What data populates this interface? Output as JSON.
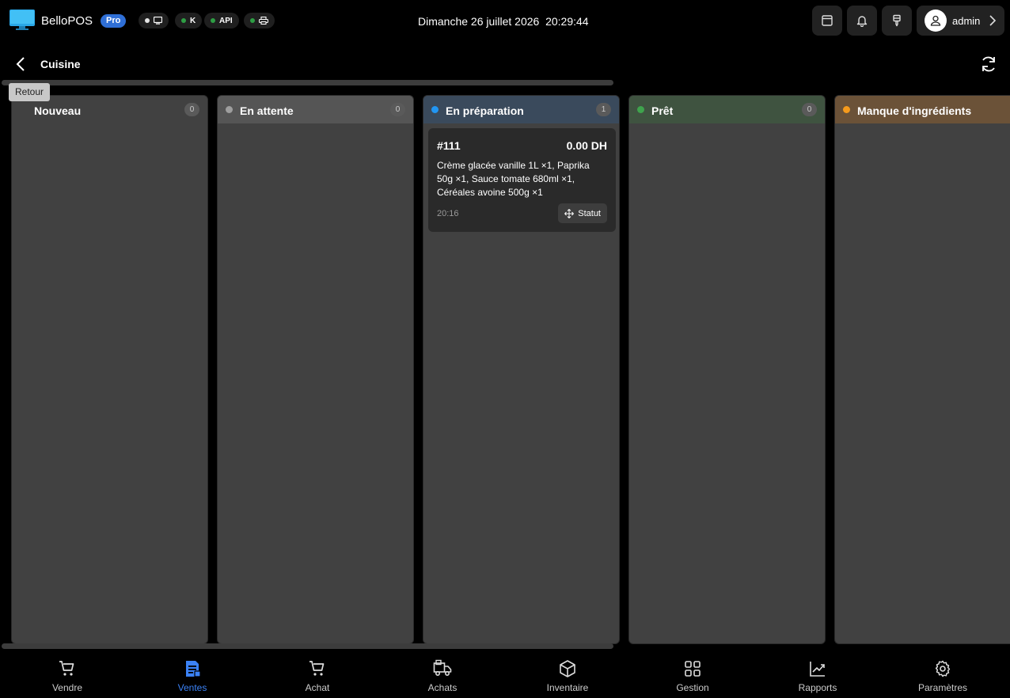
{
  "header": {
    "app_name": "BelloPOS",
    "badge": "Pro",
    "status_pills": [
      {
        "icon": "monitor-icon",
        "label": "",
        "dot_color": "#e5e5e5"
      },
      {
        "icon": "",
        "label": "K",
        "dot_color": "#2e9e44"
      },
      {
        "icon": "",
        "label": "API",
        "dot_color": "#2e9e44"
      },
      {
        "icon": "printer-icon",
        "label": "",
        "dot_color": "#2e9e44"
      }
    ],
    "datetime": "Dimanche 26 juillet 2026  20:29:44",
    "user": "admin"
  },
  "subheader": {
    "title": "Cuisine",
    "back_tooltip": "Retour"
  },
  "columns": [
    {
      "title": "Nouveau",
      "count": "0",
      "dot_color": "",
      "header_color": "#414141"
    },
    {
      "title": "En attente",
      "count": "0",
      "dot_color": "#9e9e9e",
      "header_color": "#555555"
    },
    {
      "title": "En préparation",
      "count": "1",
      "dot_color": "#2196f3",
      "header_color": "#3a4a5c"
    },
    {
      "title": "Prêt",
      "count": "0",
      "dot_color": "#3fa34d",
      "header_color": "#3f5340"
    },
    {
      "title": "Manque d'ingrédients",
      "count": "",
      "dot_color": "#f59a1c",
      "header_color": "#6b5238"
    }
  ],
  "order": {
    "number": "#111",
    "total": "0.00 DH",
    "items": "Crème glacée vanille 1L ×1, Paprika 50g ×1, Sauce tomate 680ml ×1, Céréales avoine 500g ×1",
    "time": "20:16",
    "status_label": "Statut"
  },
  "nav": [
    {
      "label": "Vendre",
      "icon": "cart-icon",
      "active": false
    },
    {
      "label": "Ventes",
      "icon": "receipt-icon",
      "active": true
    },
    {
      "label": "Achat",
      "icon": "cart-icon",
      "active": false
    },
    {
      "label": "Achats",
      "icon": "truck-icon",
      "active": false
    },
    {
      "label": "Inventaire",
      "icon": "box-icon",
      "active": false
    },
    {
      "label": "Gestion",
      "icon": "grid-icon",
      "active": false
    },
    {
      "label": "Rapports",
      "icon": "chart-icon",
      "active": false
    },
    {
      "label": "Paramètres",
      "icon": "gear-icon",
      "active": false
    }
  ],
  "colors": {
    "accent": "#3b82f6",
    "background": "#000000",
    "column_bg": "#414141"
  }
}
